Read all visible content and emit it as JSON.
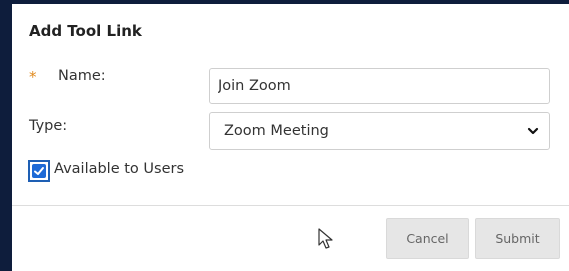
{
  "dialog": {
    "title": "Add Tool Link",
    "required_marker": "*",
    "name_label": "Name:",
    "name_value": "Join Zoom",
    "type_label": "Type:",
    "type_value": "Zoom Meeting",
    "available_label": "Available to Users",
    "available_checked": true,
    "cancel_label": "Cancel",
    "submit_label": "Submit"
  },
  "colors": {
    "frame": "#0e1d3c",
    "required": "#e08a1e",
    "checkbox": "#1e6ad6",
    "button_bg": "#e6e6e6"
  },
  "icons": {
    "select_arrow": "chevron-down-icon",
    "checkbox_mark": "checkmark-icon",
    "pointer": "mouse-cursor-icon"
  }
}
